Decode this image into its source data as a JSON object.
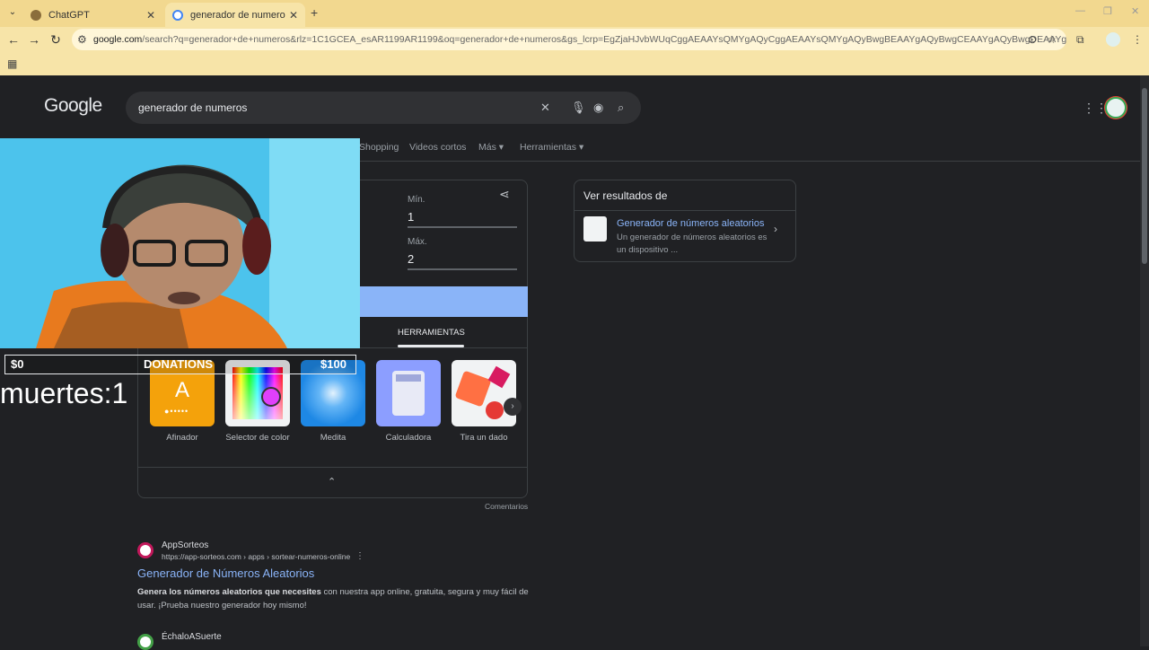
{
  "browser": {
    "tabs": [
      {
        "title": "ChatGPT",
        "favicon_color": "#8a6d3b"
      },
      {
        "title": "generador de numeros - Buscar con Google",
        "favicon_color": "#4285f4"
      }
    ],
    "new_tab_label": "+",
    "url_host": "google.com",
    "url_rest": "/search?q=generador+de+numeros&rlz=1C1GCEA_esAR1199AR1199&oq=generador+de+numeros&gs_lcrp=EgZjaHJvbWUqCggAEAAYsQMYgAQyCggAEAAYsQMYgAQyBwgBEAAYgAQyBwgCEAAYgAQyBwgDEAAYgAQyBwgEEAAYgAQyB..."
  },
  "google": {
    "logo": "Google",
    "query": "generador de numeros",
    "tabs": [
      "Shopping",
      "Videos cortos",
      "Más ▾",
      "Herramientas ▾"
    ]
  },
  "rng": {
    "min_label": "Mín.",
    "min_value": "1",
    "max_label": "Máx.",
    "max_value": "2",
    "tools_tab": "HERRAMIENTAS",
    "tools": [
      {
        "label": "Afinador"
      },
      {
        "label": "Selector de color"
      },
      {
        "label": "Medita"
      },
      {
        "label": "Calculadora"
      },
      {
        "label": "Tira un dado"
      }
    ],
    "tuner_letter": "A",
    "feedback": "Comentarios"
  },
  "side_panel": {
    "title": "Ver resultados de",
    "link": "Generador de números aleatorios",
    "desc": "Un generador de números aleatorios es un dispositivo ..."
  },
  "results": [
    {
      "site": "AppSorteos",
      "url": "https://app-sorteos.com › apps › sortear-numeros-online",
      "title": "Generador de Números Aleatorios",
      "snippet_bold": "Genera los números aleatorios que necesites",
      "snippet_rest": " con nuestra app online, gratuita, segura y muy fácil de usar. ¡Prueba nuestro generador hoy mismo!"
    },
    {
      "site": "ÉchaloASuerte"
    }
  ],
  "overlay": {
    "don_left": "$0",
    "don_center": "DONATIONS",
    "don_right": "$100",
    "muertes": "muertes:1"
  },
  "colors": {
    "accent": "#8ab4f8",
    "bg": "#202124",
    "chrome": "#f7e4a8"
  }
}
